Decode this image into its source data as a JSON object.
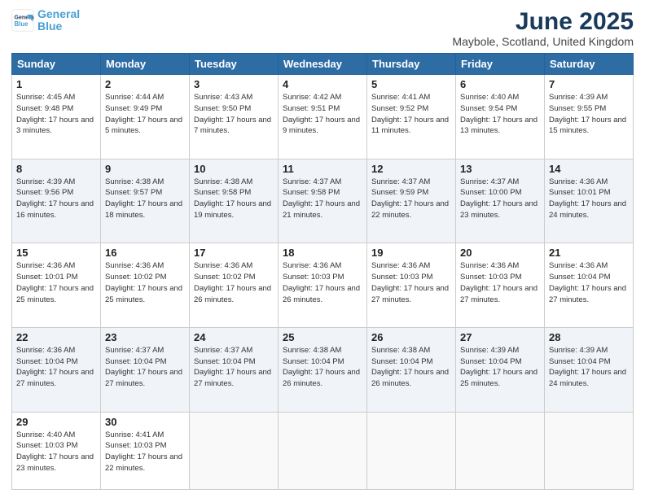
{
  "header": {
    "logo_line1": "General",
    "logo_line2": "Blue",
    "title": "June 2025",
    "subtitle": "Maybole, Scotland, United Kingdom"
  },
  "days_of_week": [
    "Sunday",
    "Monday",
    "Tuesday",
    "Wednesday",
    "Thursday",
    "Friday",
    "Saturday"
  ],
  "weeks": [
    [
      {
        "num": "1",
        "sunrise": "4:45 AM",
        "sunset": "9:48 PM",
        "daylight": "17 hours and 3 minutes."
      },
      {
        "num": "2",
        "sunrise": "4:44 AM",
        "sunset": "9:49 PM",
        "daylight": "17 hours and 5 minutes."
      },
      {
        "num": "3",
        "sunrise": "4:43 AM",
        "sunset": "9:50 PM",
        "daylight": "17 hours and 7 minutes."
      },
      {
        "num": "4",
        "sunrise": "4:42 AM",
        "sunset": "9:51 PM",
        "daylight": "17 hours and 9 minutes."
      },
      {
        "num": "5",
        "sunrise": "4:41 AM",
        "sunset": "9:52 PM",
        "daylight": "17 hours and 11 minutes."
      },
      {
        "num": "6",
        "sunrise": "4:40 AM",
        "sunset": "9:54 PM",
        "daylight": "17 hours and 13 minutes."
      },
      {
        "num": "7",
        "sunrise": "4:39 AM",
        "sunset": "9:55 PM",
        "daylight": "17 hours and 15 minutes."
      }
    ],
    [
      {
        "num": "8",
        "sunrise": "4:39 AM",
        "sunset": "9:56 PM",
        "daylight": "17 hours and 16 minutes."
      },
      {
        "num": "9",
        "sunrise": "4:38 AM",
        "sunset": "9:57 PM",
        "daylight": "17 hours and 18 minutes."
      },
      {
        "num": "10",
        "sunrise": "4:38 AM",
        "sunset": "9:58 PM",
        "daylight": "17 hours and 19 minutes."
      },
      {
        "num": "11",
        "sunrise": "4:37 AM",
        "sunset": "9:58 PM",
        "daylight": "17 hours and 21 minutes."
      },
      {
        "num": "12",
        "sunrise": "4:37 AM",
        "sunset": "9:59 PM",
        "daylight": "17 hours and 22 minutes."
      },
      {
        "num": "13",
        "sunrise": "4:37 AM",
        "sunset": "10:00 PM",
        "daylight": "17 hours and 23 minutes."
      },
      {
        "num": "14",
        "sunrise": "4:36 AM",
        "sunset": "10:01 PM",
        "daylight": "17 hours and 24 minutes."
      }
    ],
    [
      {
        "num": "15",
        "sunrise": "4:36 AM",
        "sunset": "10:01 PM",
        "daylight": "17 hours and 25 minutes."
      },
      {
        "num": "16",
        "sunrise": "4:36 AM",
        "sunset": "10:02 PM",
        "daylight": "17 hours and 25 minutes."
      },
      {
        "num": "17",
        "sunrise": "4:36 AM",
        "sunset": "10:02 PM",
        "daylight": "17 hours and 26 minutes."
      },
      {
        "num": "18",
        "sunrise": "4:36 AM",
        "sunset": "10:03 PM",
        "daylight": "17 hours and 26 minutes."
      },
      {
        "num": "19",
        "sunrise": "4:36 AM",
        "sunset": "10:03 PM",
        "daylight": "17 hours and 27 minutes."
      },
      {
        "num": "20",
        "sunrise": "4:36 AM",
        "sunset": "10:03 PM",
        "daylight": "17 hours and 27 minutes."
      },
      {
        "num": "21",
        "sunrise": "4:36 AM",
        "sunset": "10:04 PM",
        "daylight": "17 hours and 27 minutes."
      }
    ],
    [
      {
        "num": "22",
        "sunrise": "4:36 AM",
        "sunset": "10:04 PM",
        "daylight": "17 hours and 27 minutes."
      },
      {
        "num": "23",
        "sunrise": "4:37 AM",
        "sunset": "10:04 PM",
        "daylight": "17 hours and 27 minutes."
      },
      {
        "num": "24",
        "sunrise": "4:37 AM",
        "sunset": "10:04 PM",
        "daylight": "17 hours and 27 minutes."
      },
      {
        "num": "25",
        "sunrise": "4:38 AM",
        "sunset": "10:04 PM",
        "daylight": "17 hours and 26 minutes."
      },
      {
        "num": "26",
        "sunrise": "4:38 AM",
        "sunset": "10:04 PM",
        "daylight": "17 hours and 26 minutes."
      },
      {
        "num": "27",
        "sunrise": "4:39 AM",
        "sunset": "10:04 PM",
        "daylight": "17 hours and 25 minutes."
      },
      {
        "num": "28",
        "sunrise": "4:39 AM",
        "sunset": "10:04 PM",
        "daylight": "17 hours and 24 minutes."
      }
    ],
    [
      {
        "num": "29",
        "sunrise": "4:40 AM",
        "sunset": "10:03 PM",
        "daylight": "17 hours and 23 minutes."
      },
      {
        "num": "30",
        "sunrise": "4:41 AM",
        "sunset": "10:03 PM",
        "daylight": "17 hours and 22 minutes."
      },
      null,
      null,
      null,
      null,
      null
    ]
  ]
}
